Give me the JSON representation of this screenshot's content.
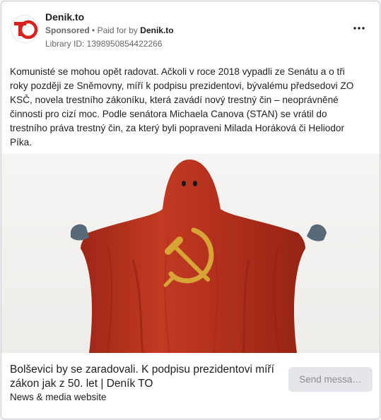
{
  "ad": {
    "page_name": "Denik.to",
    "sponsored_label": "Sponsored",
    "separator": "•",
    "paid_for_by_prefix": "Paid for by",
    "advertiser": "Denik.to",
    "library_id": "Library ID: 1398950854422266",
    "body_lines": [
      "Komunisté se mohou opět radovat. Ačkoli v roce 2018 vypadli ze Senátu a o tři",
      "roky později ze Sněmovny, míří k podpisu prezidentovi, bývalému předsedovi ZO",
      "KSČ, novela trestního zákoníku, která zavádí nový trestný čin – neoprávněné",
      "činnosti pro cizí moc. Podle senátora Michaela Canova (STAN) se vrátil do",
      "trestního práva trestný čin, za který byli popraveni Milada Horáková či Heliodor",
      "Píka."
    ],
    "headline_lines": [
      "Bolševici by se zaradovali. K podpisu prezidentovi míří",
      "zákon jak z 50. let | Deník TO"
    ],
    "caption": "News & media website",
    "cta_label": "Send messa…",
    "logo_text": "TO"
  },
  "icons": {
    "more": "more-horizontal-icon",
    "logo": "denik-to-logo",
    "image": "red-ghost-hammer-sickle-image"
  },
  "colors": {
    "brand_red": "#d7221f",
    "ghost_red": "#b8321f",
    "symbol_gold": "#d6a536",
    "cta_bg": "#e4e6eb"
  }
}
